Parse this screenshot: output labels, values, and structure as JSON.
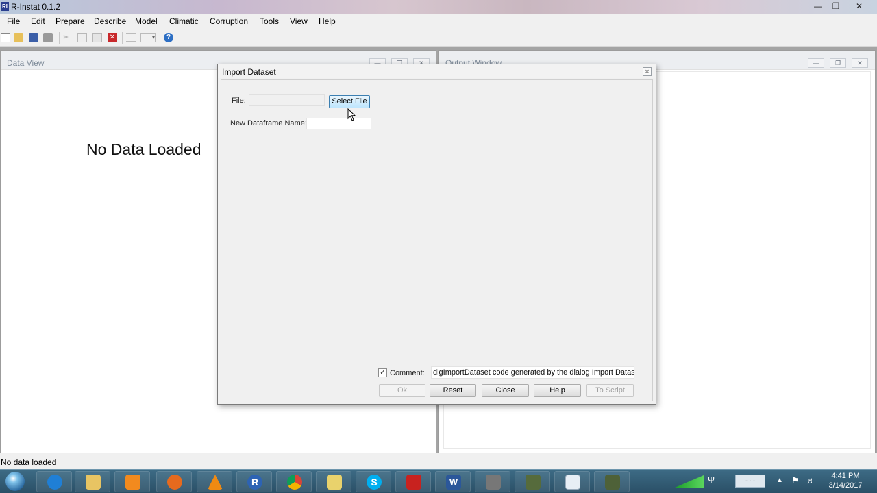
{
  "window": {
    "title": "R-Instat 0.1.2",
    "app_icon_text": "RI"
  },
  "menu": [
    "File",
    "Edit",
    "Prepare",
    "Describe",
    "Model",
    "Climatic",
    "Corruption",
    "Tools",
    "View",
    "Help"
  ],
  "data_view": {
    "title": "Data View",
    "empty_message": "No Data Loaded"
  },
  "output_window": {
    "title": "Output Window"
  },
  "dialog": {
    "title": "Import Dataset",
    "file_label": "File:",
    "file_value": "",
    "select_file_label": "Select File",
    "dataframe_label": "New Dataframe Name:",
    "dataframe_value": "",
    "comment_checked": true,
    "comment_label": "Comment:",
    "comment_value": "dlgImportDataset code generated by the dialog Import Dataset",
    "buttons": {
      "ok": "Ok",
      "reset": "Reset",
      "close": "Close",
      "help": "Help",
      "to_script": "To Script"
    }
  },
  "status": {
    "text": "No data loaded"
  },
  "taskbar": {
    "apps": [
      "internet-explorer",
      "file-explorer",
      "media-player",
      "firefox",
      "vlc",
      "r",
      "chrome",
      "folder",
      "skype",
      "acrobat",
      "word",
      "microphone",
      "r-instat",
      "notepad",
      "r-instat-alt"
    ],
    "time": "4:41 PM",
    "date": "3/14/2017"
  },
  "colors": {
    "taskbar": "#2a4f66",
    "mdi_background": "#a4a4a4",
    "dialog": "#f0f0f0"
  }
}
